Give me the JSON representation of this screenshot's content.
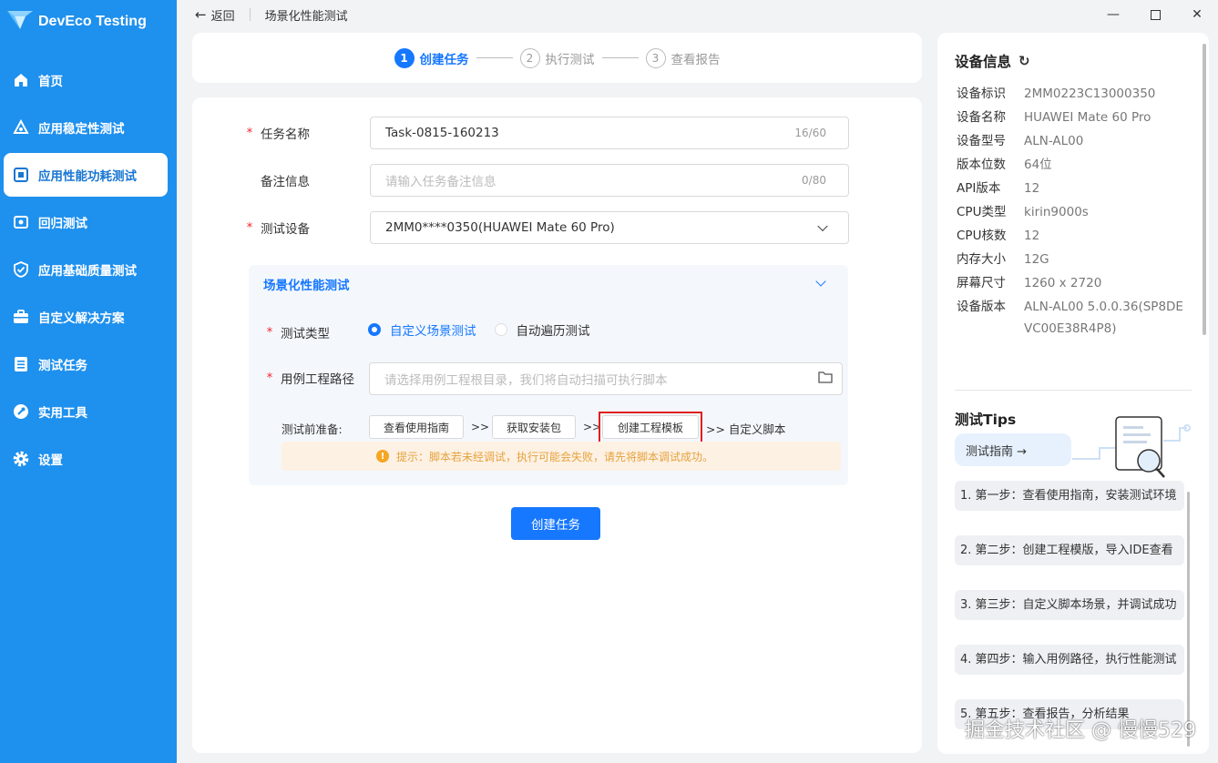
{
  "app": {
    "title": "DevEco Testing"
  },
  "sidebar": {
    "items": [
      {
        "label": "首页",
        "icon": "home-icon"
      },
      {
        "label": "应用稳定性测试",
        "icon": "stability-icon"
      },
      {
        "label": "应用性能功耗测试",
        "icon": "performance-icon",
        "active": true
      },
      {
        "label": "回归测试",
        "icon": "regression-icon"
      },
      {
        "label": "应用基础质量测试",
        "icon": "quality-check-icon"
      },
      {
        "label": "自定义解决方案",
        "icon": "briefcase-icon"
      },
      {
        "label": "测试任务",
        "icon": "task-list-icon"
      },
      {
        "label": "实用工具",
        "icon": "tools-icon"
      },
      {
        "label": "设置",
        "icon": "gear-icon"
      }
    ]
  },
  "header": {
    "back_label": "返回",
    "page_title": "场景化性能测试"
  },
  "stepper": {
    "steps": [
      {
        "num": "1",
        "label": "创建任务",
        "active": true
      },
      {
        "num": "2",
        "label": "执行测试"
      },
      {
        "num": "3",
        "label": "查看报告"
      }
    ]
  },
  "form": {
    "task_name": {
      "label": "任务名称",
      "value": "Task-0815-160213",
      "count": "16/60"
    },
    "remark": {
      "label": "备注信息",
      "placeholder": "请输入任务备注信息",
      "count": "0/80"
    },
    "device": {
      "label": "测试设备",
      "value": "2MM0****0350(HUAWEI Mate 60 Pro)"
    },
    "section": {
      "title": "场景化性能测试",
      "test_type_label": "测试类型",
      "options": [
        "自定义场景测试",
        "自动遍历测试"
      ],
      "path_label": "用例工程路径",
      "path_placeholder": "请选择用例工程根目录，我们将自动扫描可执行脚本",
      "prep_label": "测试前准备:",
      "prep_buttons": [
        "查看使用指南",
        "获取安装包",
        "创建工程模板"
      ],
      "prep_sep": ">>",
      "prep_tail": ">> 自定义脚本",
      "tip": "提示：脚本若未经调试，执行可能会失败，请先将脚本调试成功。"
    },
    "submit_label": "创建任务"
  },
  "device_info": {
    "title": "设备信息",
    "rows": [
      {
        "k": "设备标识",
        "v": "2MM0223C13000350"
      },
      {
        "k": "设备名称",
        "v": "HUAWEI Mate 60 Pro"
      },
      {
        "k": "设备型号",
        "v": "ALN-AL00"
      },
      {
        "k": "版本位数",
        "v": "64位"
      },
      {
        "k": "API版本",
        "v": "12"
      },
      {
        "k": "CPU类型",
        "v": "kirin9000s"
      },
      {
        "k": "CPU核数",
        "v": "12"
      },
      {
        "k": "内存大小",
        "v": "12G"
      },
      {
        "k": "屏幕尺寸",
        "v": "1260 x 2720"
      },
      {
        "k": "设备版本",
        "v": "ALN-AL00 5.0.0.36(SP8DEVC00E38R4P8)"
      }
    ]
  },
  "tips": {
    "title": "测试Tips",
    "guide_label": "测试指南 →",
    "steps": [
      "1. 第一步：查看使用指南，安装测试环境",
      "2. 第二步：创建工程模版，导入IDE查看",
      "3. 第三步：自定义脚本场景，并调试成功",
      "4. 第四步：输入用例路径，执行性能测试",
      "5. 第五步：查看报告，分析结果"
    ]
  },
  "watermark": "掘金技术社区 @ 慢慢529",
  "colors": {
    "sidebar": "#1e90ee",
    "accent": "#1677ff",
    "required": "#f5222d",
    "highlight_box": "#e02020"
  }
}
